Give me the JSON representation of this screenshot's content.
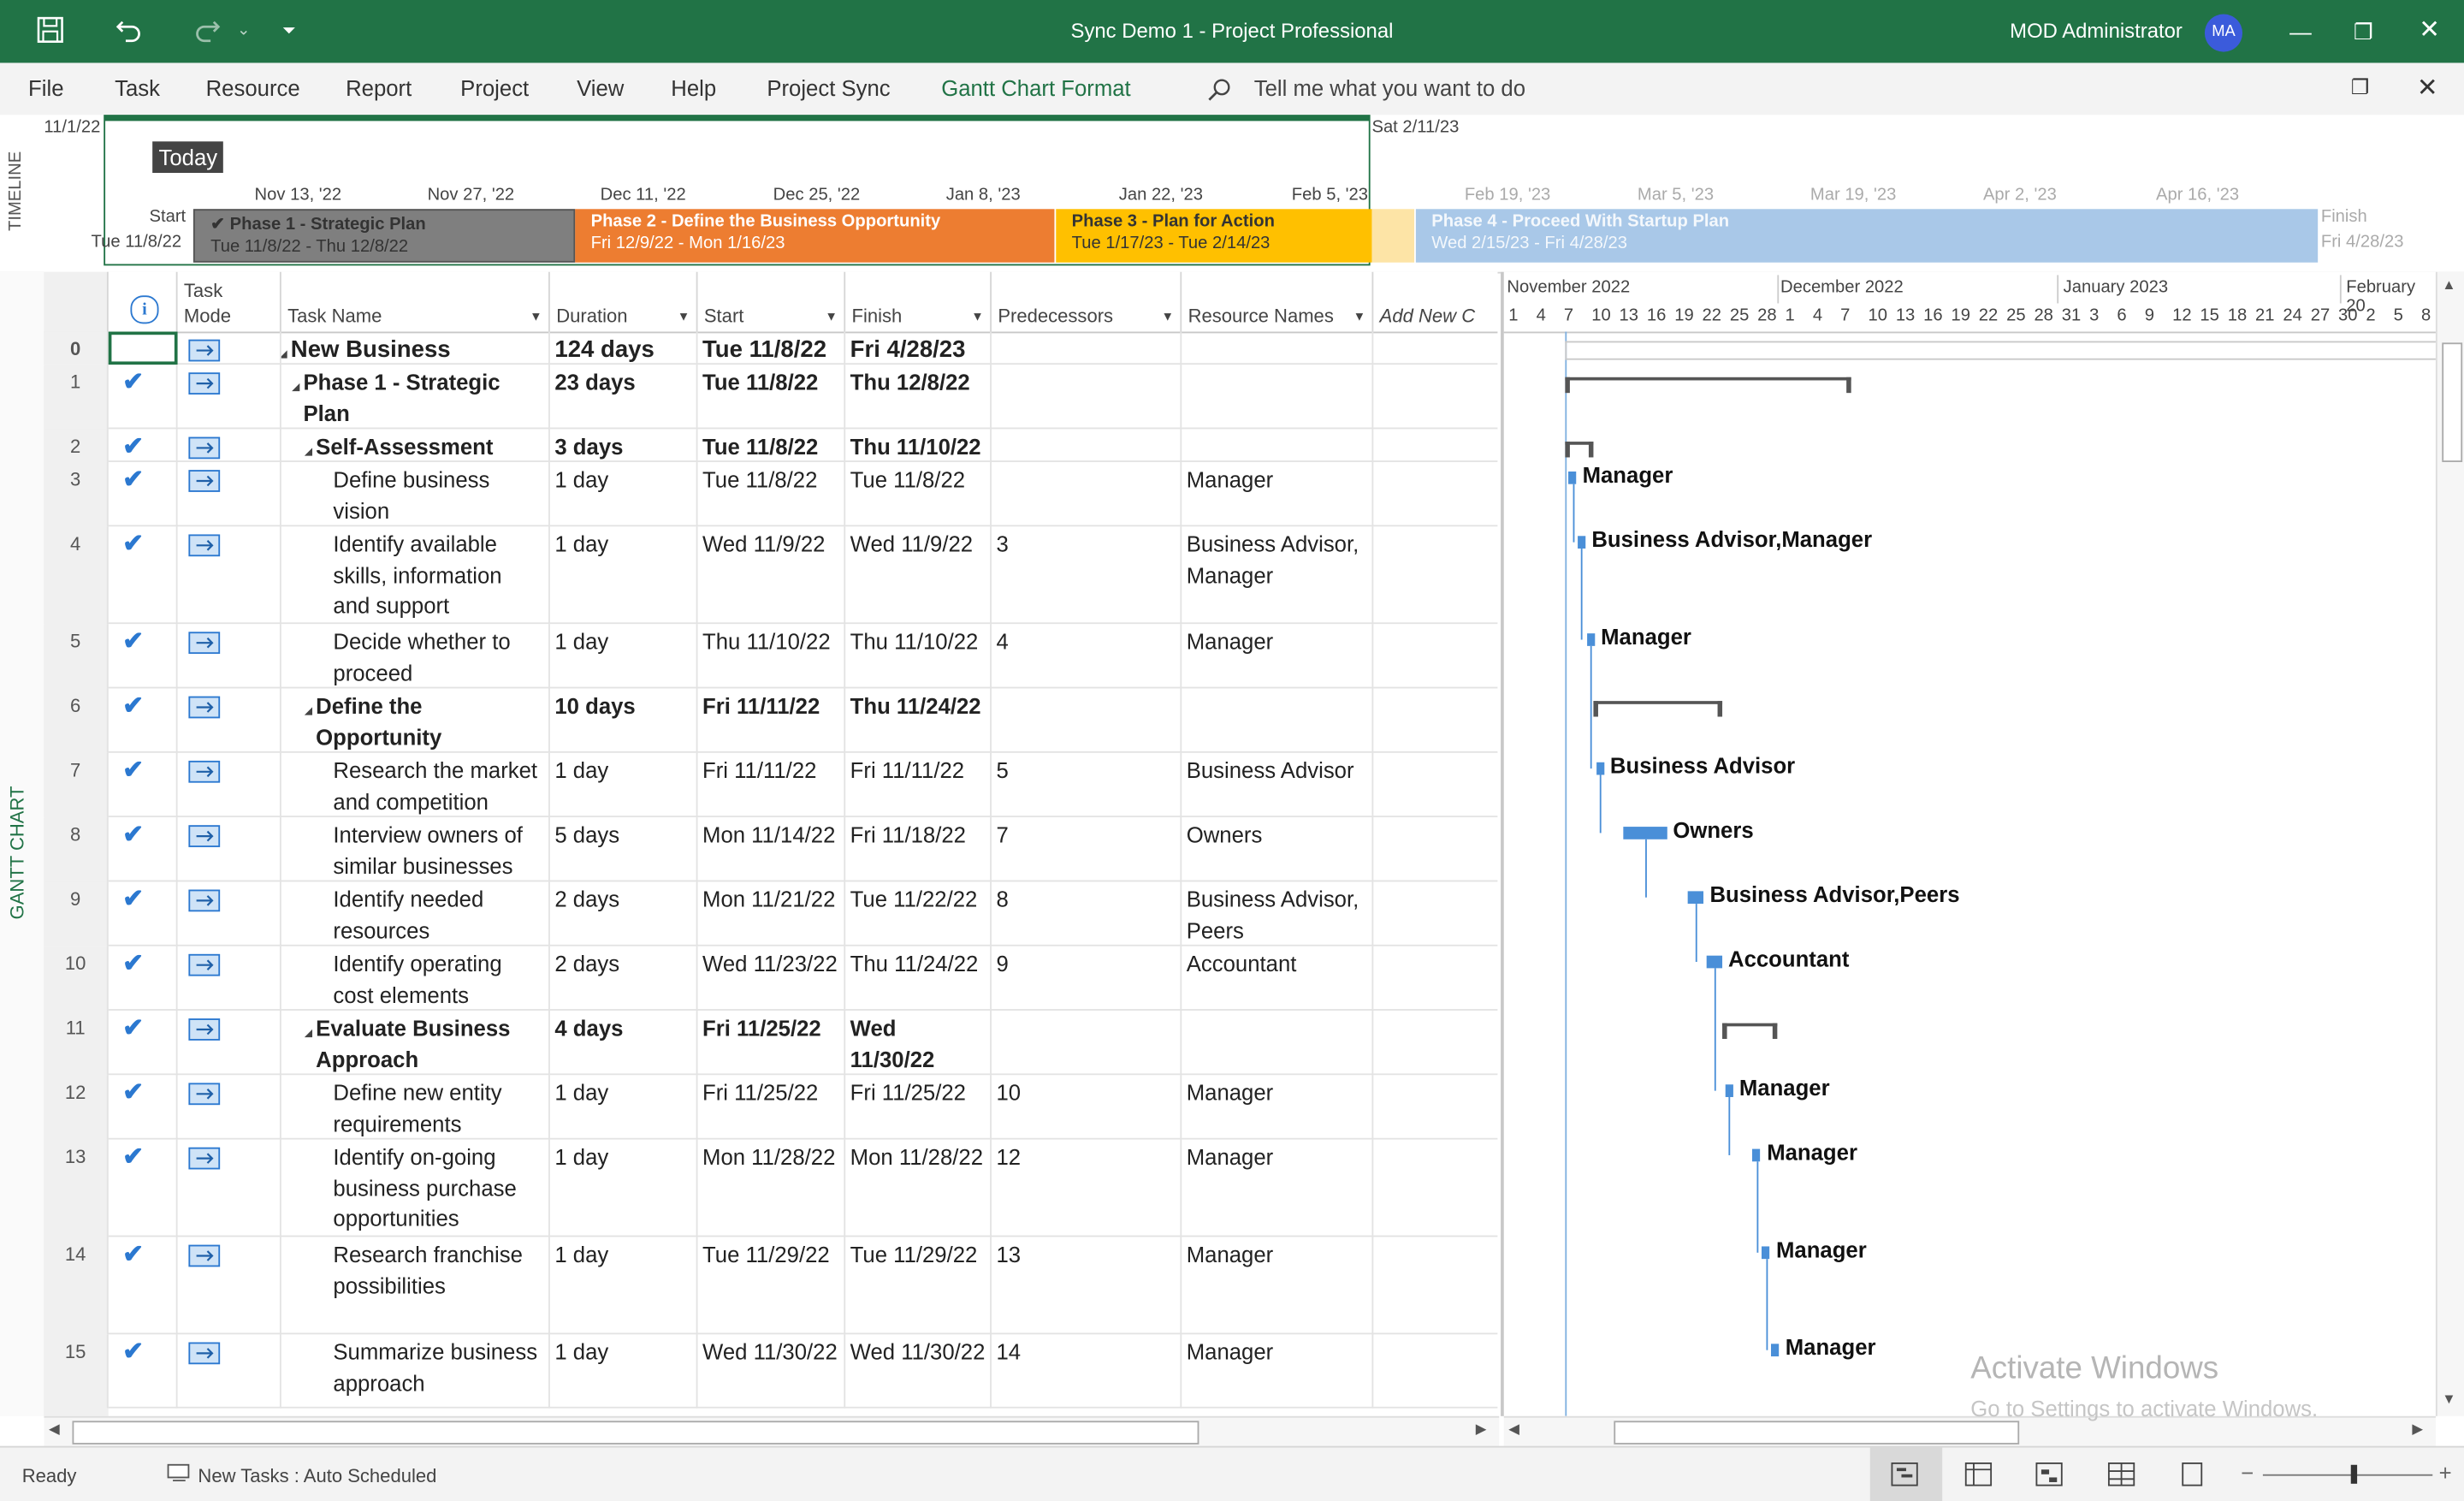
{
  "titlebar": {
    "title": "Sync Demo 1  -  Project Professional",
    "user": "MOD Administrator",
    "initials": "MA",
    "save_icon": "save-icon",
    "undo_icon": "undo-icon",
    "redo_icon": "redo-icon",
    "qat_icon": "customize-quick-access-icon"
  },
  "menu": {
    "file": "File",
    "task": "Task",
    "resource": "Resource",
    "report": "Report",
    "project": "Project",
    "view": "View",
    "help": "Help",
    "project_sync": "Project Sync",
    "gantt_format": "Gantt Chart Format",
    "tell_me": "Tell me what you want to do",
    "accent": "#217346"
  },
  "timeline": {
    "label": "TIMELINE",
    "left_date": "11/1/22",
    "right_date": "Sat 2/11/23",
    "today": "Today",
    "start_label": "Start",
    "start_date": "Tue 11/8/22",
    "finish_label": "Finish",
    "finish_date": "Fri 4/28/23",
    "dates": [
      "Nov 13, '22",
      "Nov 27, '22",
      "Dec 11, '22",
      "Dec 25, '22",
      "Jan 8, '23",
      "Jan 22, '23",
      "Feb 5, '23"
    ],
    "dates_faint": [
      "Feb 19, '23",
      "Mar 5, '23",
      "Mar 19, '23",
      "Apr 2, '23",
      "Apr 16, '23"
    ],
    "phases": [
      {
        "name": "Phase 1 - Strategic Plan",
        "dates": "Tue 11/8/22 - Thu 12/8/22",
        "color": "#7f7f7f"
      },
      {
        "name": "Phase 2 - Define the Business Opportunity",
        "dates": "Fri 12/9/22 - Mon 1/16/23",
        "color": "#ed7d31"
      },
      {
        "name": "Phase 3 - Plan for Action",
        "dates": "Tue 1/17/23 - Tue 2/14/23",
        "color": "#ffc000"
      },
      {
        "name": "Phase 4 - Proceed With Startup Plan",
        "dates": "Wed 2/15/23 - Fri 4/28/23",
        "color": "#a9c8e8"
      }
    ]
  },
  "sheet": {
    "side_label": "GANTT CHART",
    "headers": {
      "info": "i",
      "task_mode": "Task\nMode",
      "task_name": "Task Name",
      "duration": "Duration",
      "start": "Start",
      "finish": "Finish",
      "predecessors": "Predecessors",
      "resource_names": "Resource Names",
      "add_new": "Add New C"
    },
    "rows": [
      {
        "id": "0",
        "name": "New Business",
        "duration": "124 days",
        "start": "Tue 11/8/22",
        "finish": "Fri 4/28/23",
        "pred": "",
        "res": "",
        "done": false
      },
      {
        "id": "1",
        "name": "Phase 1 - Strategic Plan",
        "duration": "23 days",
        "start": "Tue 11/8/22",
        "finish": "Thu 12/8/22",
        "pred": "",
        "res": "",
        "done": true
      },
      {
        "id": "2",
        "name": "Self-Assessment",
        "duration": "3 days",
        "start": "Tue 11/8/22",
        "finish": "Thu 11/10/22",
        "pred": "",
        "res": "",
        "done": true
      },
      {
        "id": "3",
        "name": "Define business vision",
        "duration": "1 day",
        "start": "Tue 11/8/22",
        "finish": "Tue 11/8/22",
        "pred": "",
        "res": "Manager",
        "done": true
      },
      {
        "id": "4",
        "name": "Identify available skills, information and support",
        "duration": "1 day",
        "start": "Wed 11/9/22",
        "finish": "Wed 11/9/22",
        "pred": "3",
        "res": "Business Advisor, Manager",
        "done": true
      },
      {
        "id": "5",
        "name": "Decide whether to proceed",
        "duration": "1 day",
        "start": "Thu 11/10/22",
        "finish": "Thu 11/10/22",
        "pred": "4",
        "res": "Manager",
        "done": true
      },
      {
        "id": "6",
        "name": "Define the Opportunity",
        "duration": "10 days",
        "start": "Fri 11/11/22",
        "finish": "Thu 11/24/22",
        "pred": "",
        "res": "",
        "done": true
      },
      {
        "id": "7",
        "name": "Research the market and competition",
        "duration": "1 day",
        "start": "Fri 11/11/22",
        "finish": "Fri 11/11/22",
        "pred": "5",
        "res": "Business Advisor",
        "done": true
      },
      {
        "id": "8",
        "name": "Interview owners of similar businesses",
        "duration": "5 days",
        "start": "Mon 11/14/22",
        "finish": "Fri 11/18/22",
        "pred": "7",
        "res": "Owners",
        "done": true
      },
      {
        "id": "9",
        "name": "Identify needed resources",
        "duration": "2 days",
        "start": "Mon 11/21/22",
        "finish": "Tue 11/22/22",
        "pred": "8",
        "res": "Business Advisor, Peers",
        "done": true
      },
      {
        "id": "10",
        "name": "Identify operating cost elements",
        "duration": "2 days",
        "start": "Wed 11/23/22",
        "finish": "Thu 11/24/22",
        "pred": "9",
        "res": "Accountant",
        "done": true
      },
      {
        "id": "11",
        "name": "Evaluate Business Approach",
        "duration": "4 days",
        "start": "Fri 11/25/22",
        "finish": "Wed 11/30/22",
        "pred": "",
        "res": "",
        "done": true
      },
      {
        "id": "12",
        "name": "Define new entity requirements",
        "duration": "1 day",
        "start": "Fri 11/25/22",
        "finish": "Fri 11/25/22",
        "pred": "10",
        "res": "Manager",
        "done": true
      },
      {
        "id": "13",
        "name": "Identify on-going business purchase opportunities",
        "duration": "1 day",
        "start": "Mon 11/28/22",
        "finish": "Mon 11/28/22",
        "pred": "12",
        "res": "Manager",
        "done": true
      },
      {
        "id": "14",
        "name": "Research franchise possibilities",
        "duration": "1 day",
        "start": "Tue 11/29/22",
        "finish": "Tue 11/29/22",
        "pred": "13",
        "res": "Manager",
        "done": true
      },
      {
        "id": "15",
        "name": "Summarize business approach",
        "duration": "1 day",
        "start": "Wed 11/30/22",
        "finish": "Wed 11/30/22",
        "pred": "14",
        "res": "Manager",
        "done": true
      }
    ]
  },
  "gantt": {
    "months": [
      "November 2022",
      "December 2022",
      "January 2023",
      "February 20"
    ],
    "days": [
      "1",
      "4",
      "7",
      "10",
      "13",
      "16",
      "19",
      "22",
      "25",
      "28",
      "1",
      "4",
      "7",
      "10",
      "13",
      "16",
      "19",
      "22",
      "25",
      "28",
      "31",
      "3",
      "6",
      "9",
      "12",
      "15",
      "18",
      "21",
      "24",
      "27",
      "30",
      "2",
      "5",
      "8"
    ],
    "bar_labels": [
      "Manager",
      "Business Advisor,Manager",
      "Manager",
      "Business Advisor",
      "Owners",
      "Business Advisor,Peers",
      "Accountant",
      "Manager",
      "Manager",
      "Manager",
      "Manager"
    ]
  },
  "status": {
    "ready": "Ready",
    "new_tasks": "New Tasks : Auto Scheduled"
  },
  "watermark": {
    "line1": "Activate Windows",
    "line2": "Go to Settings to activate Windows."
  }
}
